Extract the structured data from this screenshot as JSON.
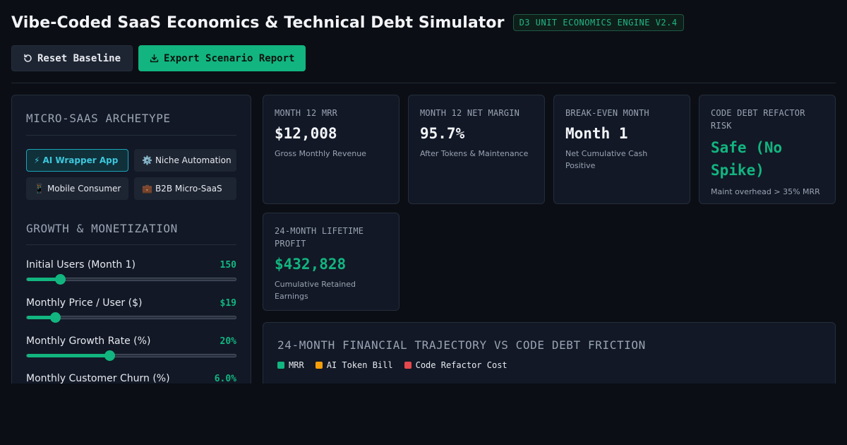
{
  "header": {
    "title": "Vibe-Coded SaaS Economics & Technical Debt Simulator",
    "version_badge": "D3 UNIT ECONOMICS ENGINE V2.4"
  },
  "actions": {
    "reset_label": "Reset Baseline",
    "export_label": "Export Scenario Report"
  },
  "sidebar": {
    "archetype_heading": "MICRO-SAAS ARCHETYPE",
    "archetypes": [
      {
        "icon": "⚡",
        "label": "AI Wrapper App",
        "active": true
      },
      {
        "icon": "⚙️",
        "label": "Niche Automation",
        "active": false
      },
      {
        "icon": "📱",
        "label": "Mobile Consumer",
        "active": false
      },
      {
        "icon": "💼",
        "label": "B2B Micro-SaaS",
        "active": false
      }
    ],
    "growth_heading": "GROWTH & MONETIZATION",
    "sliders": [
      {
        "label": "Initial Users (Month 1)",
        "value": "150",
        "fill": 0.16
      },
      {
        "label": "Monthly Price / User ($)",
        "value": "$19",
        "fill": 0.135
      },
      {
        "label": "Monthly Growth Rate (%)",
        "value": "20%",
        "fill": 0.395
      },
      {
        "label": "Monthly Customer Churn (%)",
        "value": "6.0%",
        "fill": 0.3
      }
    ]
  },
  "kpis": [
    {
      "label": "MONTH 12 MRR",
      "value": "$12,008",
      "sub": "Gross Monthly Revenue"
    },
    {
      "label": "MONTH 12 NET MARGIN",
      "value": "95.7%",
      "sub": "After Tokens & Maintenance"
    },
    {
      "label": "BREAK-EVEN MONTH",
      "value": "Month 1",
      "sub": "Net Cumulative Cash Positive"
    },
    {
      "label": "CODE DEBT REFACTOR RISK",
      "value": "Safe (No Spike)",
      "sub": "Maint overhead > 35% MRR"
    },
    {
      "label": "24-MONTH LIFETIME PROFIT",
      "value": "$432,828",
      "sub": "Cumulative Retained Earnings"
    }
  ],
  "chart": {
    "title": "24-MONTH FINANCIAL TRAJECTORY VS CODE DEBT FRICTION",
    "legend": [
      {
        "label": "MRR",
        "color": "#12b57f"
      },
      {
        "label": "AI Token Bill",
        "color": "#f59e0b"
      },
      {
        "label": "Code Refactor Cost",
        "color": "#e5484d"
      }
    ]
  },
  "colors": {
    "accent": "#12b57f",
    "active_archetype": "#1ba5b8",
    "background": "#0b0e14",
    "panel": "#121826"
  }
}
